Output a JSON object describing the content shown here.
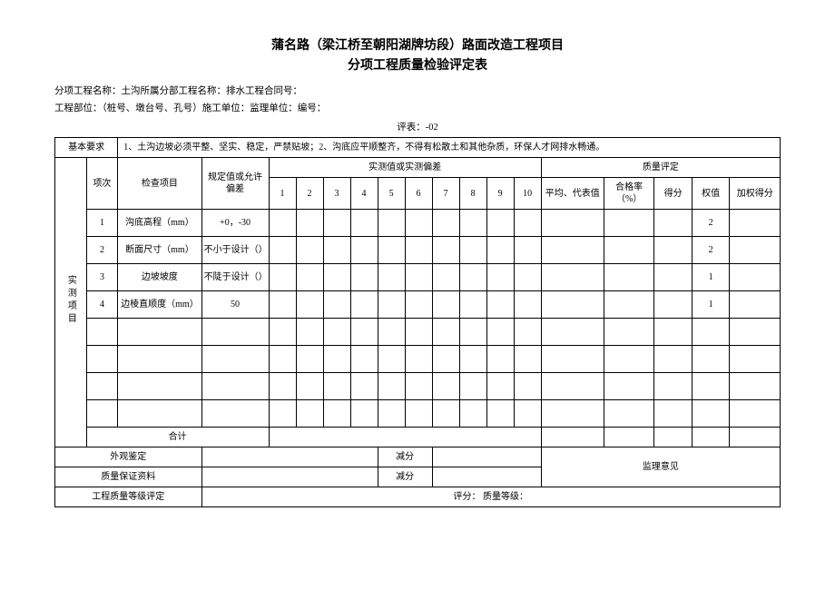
{
  "title": {
    "line1": "蒲名路（梁江桥至朝阳湖牌坊段）路面改造工程项目",
    "line2": "分项工程质量检验评定表"
  },
  "meta": {
    "line1": "分项工程名称：土沟所属分部工程名称：排水工程合同号：",
    "line2": "工程部位：（桩号、墩台号、孔号）施工单位：监理单位：编号："
  },
  "eval_no": "评表：-02",
  "basic_req_label": "基本要求",
  "basic_req_text": "1、土沟边坡必须平整、坚实、稳定，严禁贴坡；2、沟底应平顺整齐，不得有松散土和其他杂质，环保人才网排水畅通。",
  "headers": {
    "item_no": "项次",
    "check_item": "检查项目",
    "spec_value": "规定值或允许偏差",
    "measured_group": "实测值或实测偏差",
    "quality_group": "质量评定",
    "cols": [
      "1",
      "2",
      "3",
      "4",
      "5",
      "6",
      "7",
      "8",
      "9",
      "10"
    ],
    "avg_rep": "平均、代表值",
    "pass_rate": "合格率（%）",
    "score": "得分",
    "weight": "权值",
    "weighted": "加权得分"
  },
  "side_label_measure": "实测项目",
  "rows": [
    {
      "no": "1",
      "item": "沟底高程（mm）",
      "spec": "+0，-30",
      "weight": "2"
    },
    {
      "no": "2",
      "item": "断面尺寸（mm）",
      "spec": "不小于设计（）",
      "weight": "2"
    },
    {
      "no": "3",
      "item": "边坡坡度",
      "spec": "不陡于设计（）",
      "weight": "1"
    },
    {
      "no": "4",
      "item": "边棱直顺度（mm）",
      "spec": "50",
      "weight": "1"
    }
  ],
  "sum_label": "合计",
  "footer": {
    "appearance": "外观鉴定",
    "deduct": "减分",
    "qa_doc": "质量保证资料",
    "supervisor": "监理意见",
    "grade_eval": "工程质量等级评定",
    "grade_text": "评分：  质量等级："
  }
}
